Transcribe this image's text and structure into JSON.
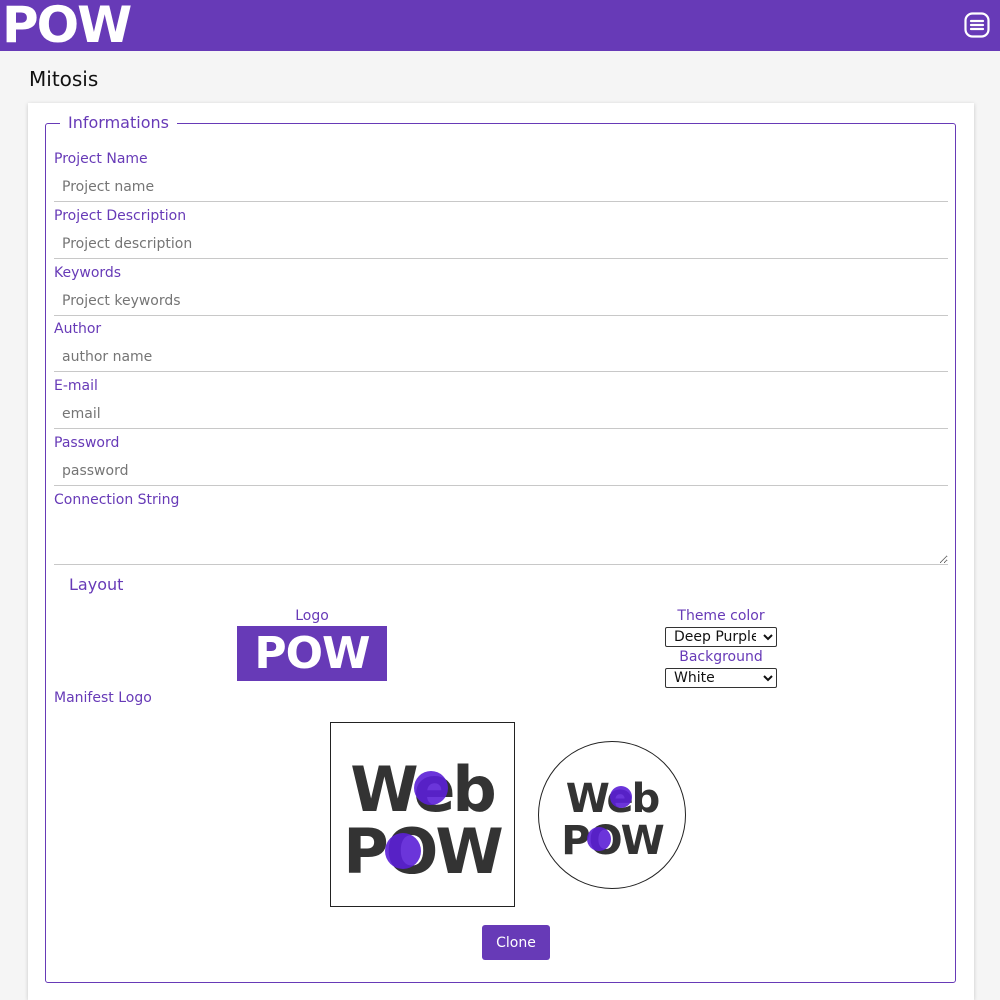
{
  "header": {
    "brand": "POW",
    "menu_icon": "menu-icon",
    "color": "#673ab7"
  },
  "page": {
    "title": "Mitosis"
  },
  "form": {
    "legend": "Informations",
    "fields": [
      {
        "label": "Project Name",
        "placeholder": "Project name"
      },
      {
        "label": "Project Description",
        "placeholder": "Project description"
      },
      {
        "label": "Keywords",
        "placeholder": "Project keywords"
      },
      {
        "label": "Author",
        "placeholder": "author name"
      },
      {
        "label": "E-mail",
        "placeholder": "email"
      },
      {
        "label": "Password",
        "placeholder": "password"
      }
    ],
    "connection_label": "Connection String"
  },
  "layout": {
    "title": "Layout",
    "logo_label": "Logo",
    "logo_text": "POW",
    "theme_label": "Theme color",
    "theme_value": "Deep Purple",
    "background_label": "Background",
    "background_value": "White",
    "manifest_label": "Manifest Logo",
    "manifest_line1": "Web",
    "manifest_line2": "POW"
  },
  "actions": {
    "clone_label": "Clone"
  }
}
